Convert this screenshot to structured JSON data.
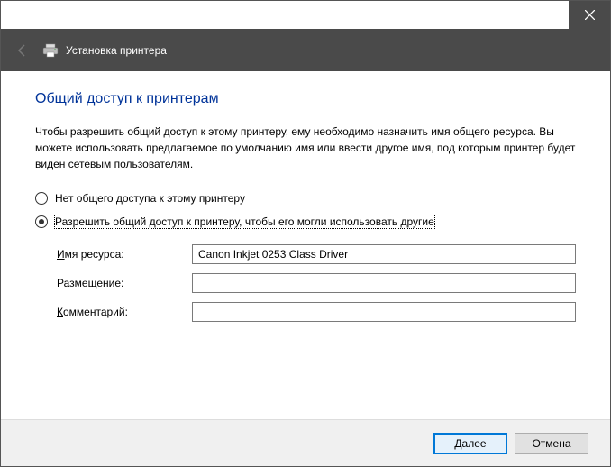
{
  "header": {
    "wizard_title": "Установка принтера"
  },
  "page": {
    "title": "Общий доступ к принтерам",
    "description": "Чтобы разрешить общий доступ к этому принтеру, ему необходимо назначить имя общего ресурса. Вы можете использовать предлагаемое по умолчанию имя или ввести другое имя, под которым принтер будет виден сетевым пользователям."
  },
  "options": {
    "no_share": {
      "label": "Нет общего доступа к этому принтеру",
      "selected": false
    },
    "share": {
      "label": "Разрешить общий доступ к принтеру, чтобы его могли использовать другие",
      "selected": true
    }
  },
  "form": {
    "share_name": {
      "label_pre": "",
      "label_mn": "И",
      "label_post": "мя ресурса:",
      "value": "Canon Inkjet 0253 Class Driver"
    },
    "location": {
      "label_pre": "",
      "label_mn": "Р",
      "label_post": "азмещение:",
      "value": ""
    },
    "comment": {
      "label_pre": "",
      "label_mn": "К",
      "label_post": "омментарий:",
      "value": ""
    }
  },
  "footer": {
    "next_pre": "",
    "next_mn": "Д",
    "next_post": "алее",
    "cancel": "Отмена"
  }
}
